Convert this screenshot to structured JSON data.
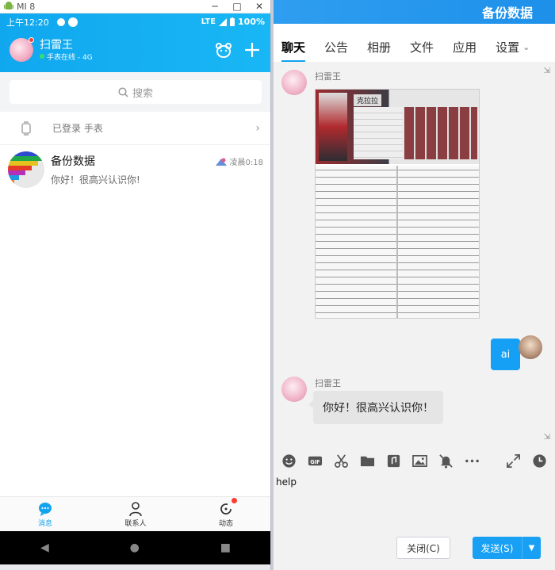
{
  "emulator": {
    "title": "MI 8",
    "minimize": "─",
    "maximize": "□",
    "close": "✕"
  },
  "statusbar": {
    "time": "上午12:20",
    "network": "LTE",
    "battery": "100%"
  },
  "profile": {
    "name": "扫雷王",
    "status": "手表在线 - 4G"
  },
  "search": {
    "placeholder": "搜索"
  },
  "device_row": {
    "label": "已登录 手表"
  },
  "conversation": {
    "name": "备份数据",
    "last_message": "你好！很高兴认识你!",
    "meta": "凌晨0:18"
  },
  "tabbar": {
    "messages": "消息",
    "contacts": "联系人",
    "moments": "动态"
  },
  "window": {
    "title": "备份数据"
  },
  "tabs": [
    {
      "label": "聊天"
    },
    {
      "label": "公告"
    },
    {
      "label": "相册"
    },
    {
      "label": "文件"
    },
    {
      "label": "应用"
    },
    {
      "label": "设置"
    }
  ],
  "messages": {
    "sender1": "扫雷王",
    "image_card": {
      "name": "克拉拉"
    },
    "my_message": "ai",
    "sender2": "扫雷王",
    "reply": "你好！很高兴认识你！"
  },
  "input": {
    "value": "help"
  },
  "buttons": {
    "close": "关闭(C)",
    "send": "发送(S)"
  },
  "colors": {
    "accent": "#17a0f4",
    "header": "#10a7ee"
  }
}
